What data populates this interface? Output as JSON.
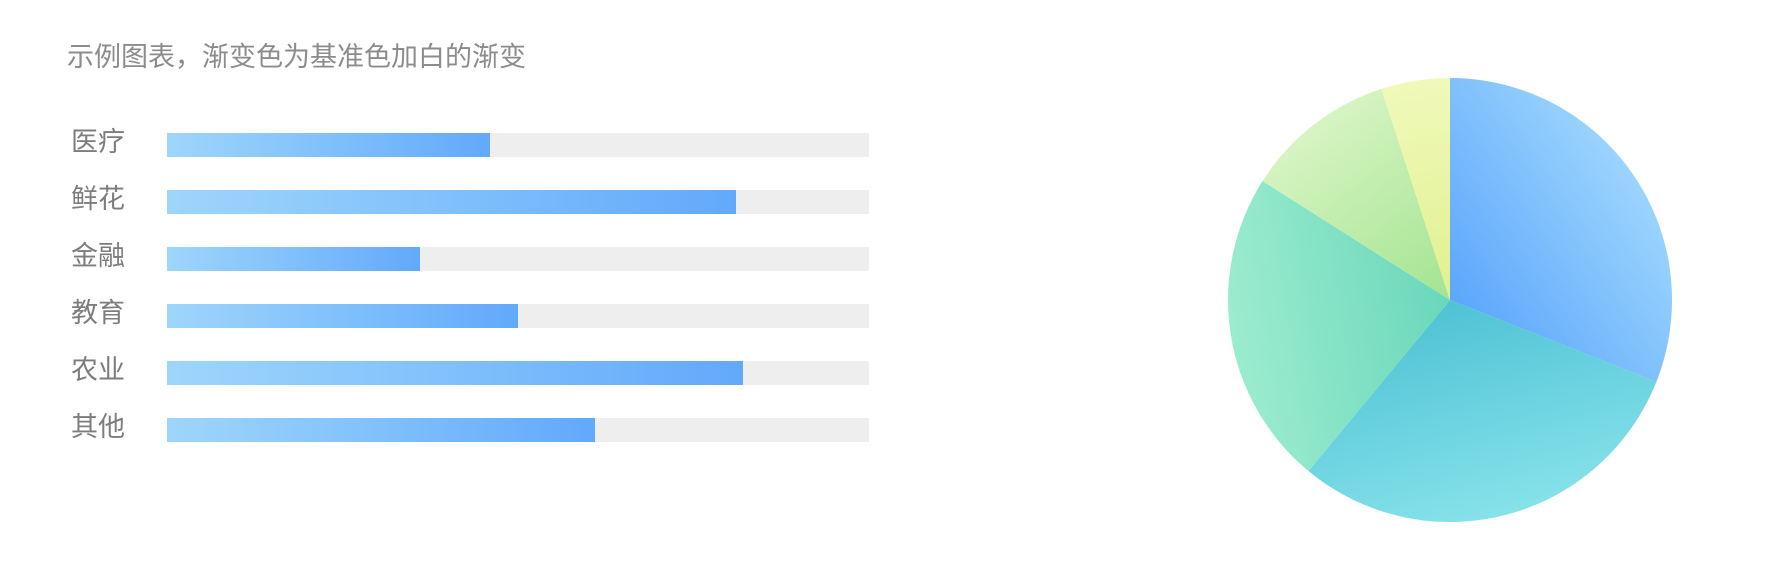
{
  "title": "示例图表，渐变色为基准色加白的渐变",
  "chart_data": [
    {
      "type": "bar",
      "orientation": "horizontal",
      "categories": [
        "医疗",
        "鲜花",
        "金融",
        "教育",
        "农业",
        "其他"
      ],
      "values": [
        46,
        81,
        36,
        50,
        82,
        61
      ],
      "xlim": [
        0,
        100
      ],
      "track_color": "#eeeeee",
      "gradient": [
        "#9ed6fb",
        "#62a9fb"
      ]
    },
    {
      "type": "pie",
      "labels": [],
      "values": [
        31,
        30,
        23,
        11,
        5
      ],
      "start_angle_deg": 0,
      "colors": [
        [
          "#5ca6fb",
          "#9bd4fd"
        ],
        [
          "#4fc2d4",
          "#86e2ea"
        ],
        [
          "#6ad7ba",
          "#9ceccf"
        ],
        [
          "#a3e491",
          "#d6f4c2"
        ],
        [
          "#e0f18e",
          "#f0f9ba"
        ]
      ]
    }
  ]
}
